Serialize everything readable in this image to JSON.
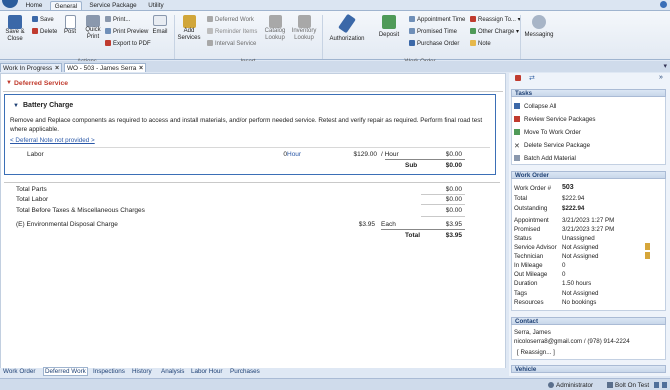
{
  "menu": {
    "tabs": [
      "Home",
      "General",
      "Service Package",
      "Utility"
    ],
    "active": "General"
  },
  "ribbon": {
    "save_close": "Save & Close",
    "save": "Save",
    "delete": "Delete",
    "post": "Post",
    "quick_print": "Quick Print",
    "print": "Print...",
    "print_preview": "Print Preview",
    "export_pdf": "Export to PDF",
    "email": "Email",
    "actions_group": "Actions",
    "add_services": "Add Services",
    "deferred_work": "Deferred Work",
    "reminder_items": "Reminder Items",
    "interval_service": "Interval Service",
    "catalog_lookup": "Catalog Lookup",
    "inventory_lookup": "Inventory Lookup",
    "insert_group": "Insert",
    "authorization": "Authorization",
    "deposit": "Deposit",
    "appointment_time": "Appointment Time",
    "promised_time": "Promised Time",
    "purchase_order": "Purchase Order",
    "reassign_to": "Reassign To...",
    "other_charge": "Other Charge",
    "note": "Note",
    "work_order_group": "Work Order",
    "messaging": "Messaging"
  },
  "doc_tabs": [
    "Work In Progress",
    "WO - 503 - James Serra"
  ],
  "main": {
    "section_title": "Deferred Service",
    "package": {
      "title": "Battery Charge",
      "description": "Remove and Replace components as required to access and install materials, and/or perform needed service.  Retest and verify repair as required.  Perform final road test where applicable.",
      "deferral_link": "< Deferral Note not provided >",
      "labor": {
        "label": "Labor",
        "qty": "0",
        "unit": "Hour",
        "rate": "$129.00",
        "per": "/ Hour",
        "amount": "$0.00"
      },
      "sub_label": "Sub",
      "sub_amount": "$0.00"
    },
    "totals": [
      {
        "label": "Total Parts",
        "amount": "$0.00"
      },
      {
        "label": "Total Labor",
        "amount": "$0.00"
      },
      {
        "label": "Total Before Taxes & Miscellaneous Charges",
        "amount": "$0.00"
      }
    ],
    "fee": {
      "label": "(E) Environmental Disposal Charge",
      "price": "$3.95",
      "each": "Each",
      "amount": "$3.95"
    },
    "total_label": "Total",
    "total_amount": "$3.95"
  },
  "tasks": {
    "title": "Tasks",
    "items": [
      "Collapse All",
      "Review Service Packages",
      "Move To Work Order",
      "Delete Service Package",
      "Batch Add Material"
    ]
  },
  "work_order": {
    "title": "Work Order",
    "fields": [
      {
        "label": "Work Order #",
        "value": "503"
      },
      {
        "label": "Total",
        "value": "$222.94"
      },
      {
        "label": "Outstanding",
        "value": "$222.94"
      },
      {
        "label": "Appointment",
        "value": "3/21/2023 1:27 PM"
      },
      {
        "label": "Promised",
        "value": "3/21/2023 3:27 PM"
      },
      {
        "label": "Status",
        "value": "Unassigned"
      },
      {
        "label": "Service Advisor",
        "value": "Not Assigned"
      },
      {
        "label": "Technician",
        "value": "Not Assigned"
      },
      {
        "label": "In Mileage",
        "value": "0"
      },
      {
        "label": "Out Mileage",
        "value": "0"
      },
      {
        "label": "Duration",
        "value": "1.50 hours"
      },
      {
        "label": "Tags",
        "value": "Not Assigned"
      },
      {
        "label": "Resources",
        "value": "No bookings"
      }
    ]
  },
  "contact": {
    "title": "Contact",
    "name": "Serra, James",
    "email_phone": "nicoloserra8@gmail.com / (978) 914-2224",
    "reassign": "[ Reassign... ]"
  },
  "vehicle": {
    "title": "Vehicle"
  },
  "bottom_tabs": [
    "Work Order",
    "Deferred Work",
    "Inspections",
    "History",
    "Analysis",
    "Labor Hour",
    "Purchases"
  ],
  "status_bar": {
    "user": "Administrator",
    "store": "Bolt On Test"
  }
}
